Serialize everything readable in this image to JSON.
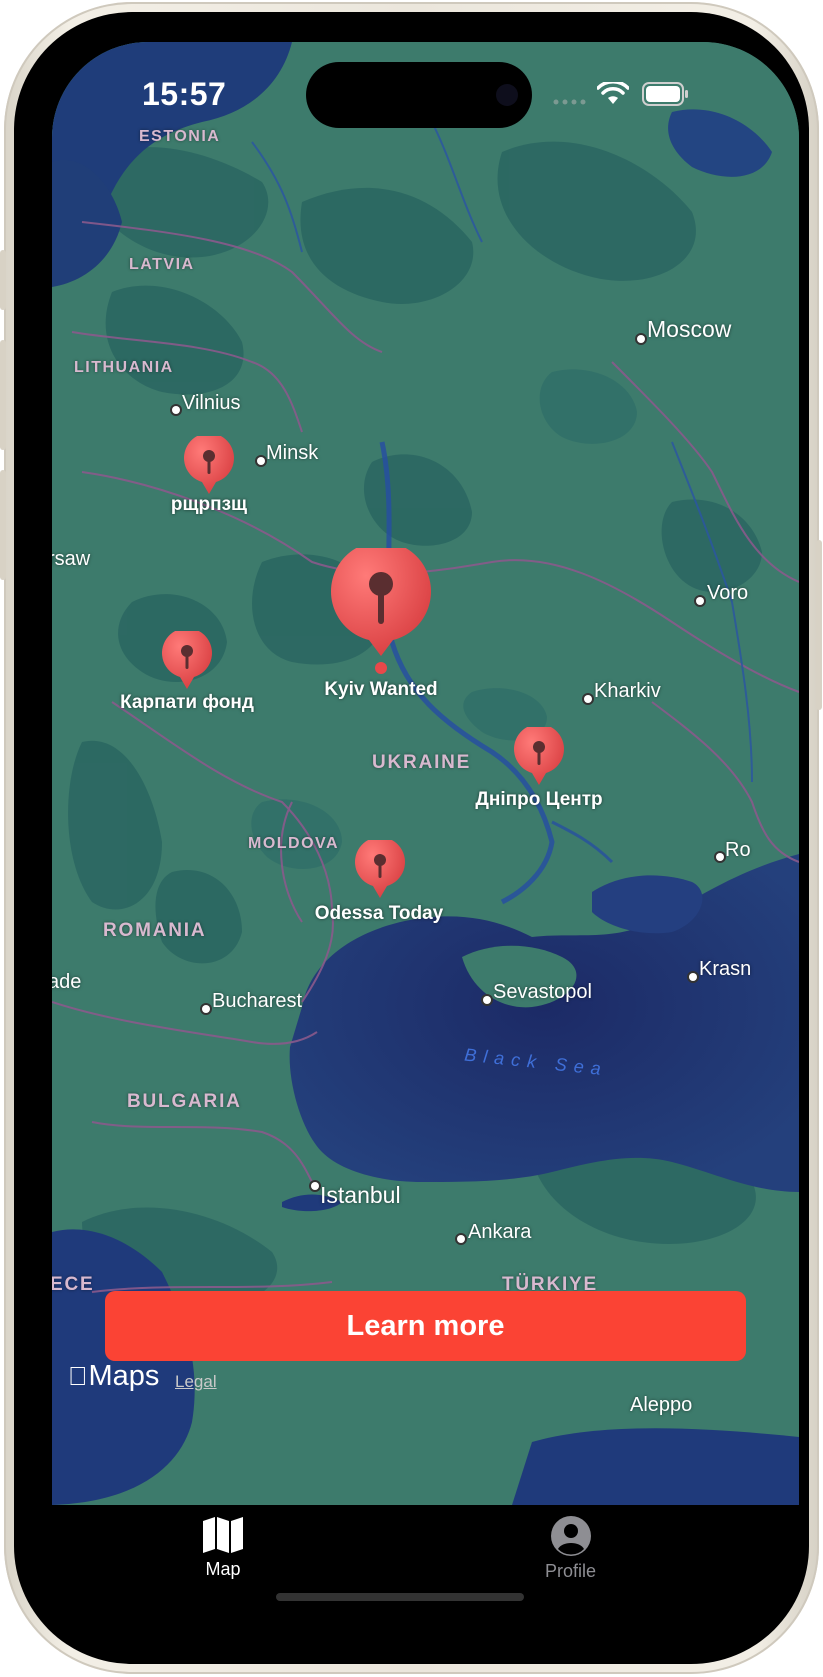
{
  "status_bar": {
    "time": "15:57"
  },
  "map": {
    "cities": [
      {
        "name": "Moscow",
        "big": true
      },
      {
        "name": "Vilnius"
      },
      {
        "name": "Minsk"
      },
      {
        "name": "rsaw"
      },
      {
        "name": "Voro"
      },
      {
        "name": "Kharkiv"
      },
      {
        "name": "Ro"
      },
      {
        "name": "Krasn"
      },
      {
        "name": "Sevastopol"
      },
      {
        "name": "ade"
      },
      {
        "name": "Bucharest"
      },
      {
        "name": "Istanbul",
        "big": true
      },
      {
        "name": "Ankara"
      },
      {
        "name": "Aleppo"
      }
    ],
    "countries": [
      {
        "name": "ESTONIA"
      },
      {
        "name": "LATVIA"
      },
      {
        "name": "LITHUANIA"
      },
      {
        "name": "UKRAINE",
        "big": true
      },
      {
        "name": "MOLDOVA"
      },
      {
        "name": "ROMANIA",
        "big": true
      },
      {
        "name": "BULGARIA",
        "big": true
      },
      {
        "name": "TÜRKIYE",
        "big": true
      },
      {
        "name": "ECE",
        "big": true
      }
    ],
    "sea_label": "Black Sea",
    "pins": [
      {
        "label": "рщрпзщ",
        "selected": false
      },
      {
        "label": "Карпати фонд",
        "selected": false
      },
      {
        "label": "Kyiv Wanted",
        "selected": true
      },
      {
        "label": "Дніпро Центр",
        "selected": false
      },
      {
        "label": "Odessa Today",
        "selected": false
      }
    ],
    "pin_color": "#e8484a",
    "attribution": {
      "maps": "Maps",
      "legal": "Legal"
    }
  },
  "cta": {
    "label": "Learn more",
    "color": "#fb4334"
  },
  "tab_bar": {
    "tabs": [
      {
        "label": "Map",
        "icon": "map-icon",
        "active": true
      },
      {
        "label": "Profile",
        "icon": "person-circle-icon",
        "active": false
      }
    ]
  }
}
